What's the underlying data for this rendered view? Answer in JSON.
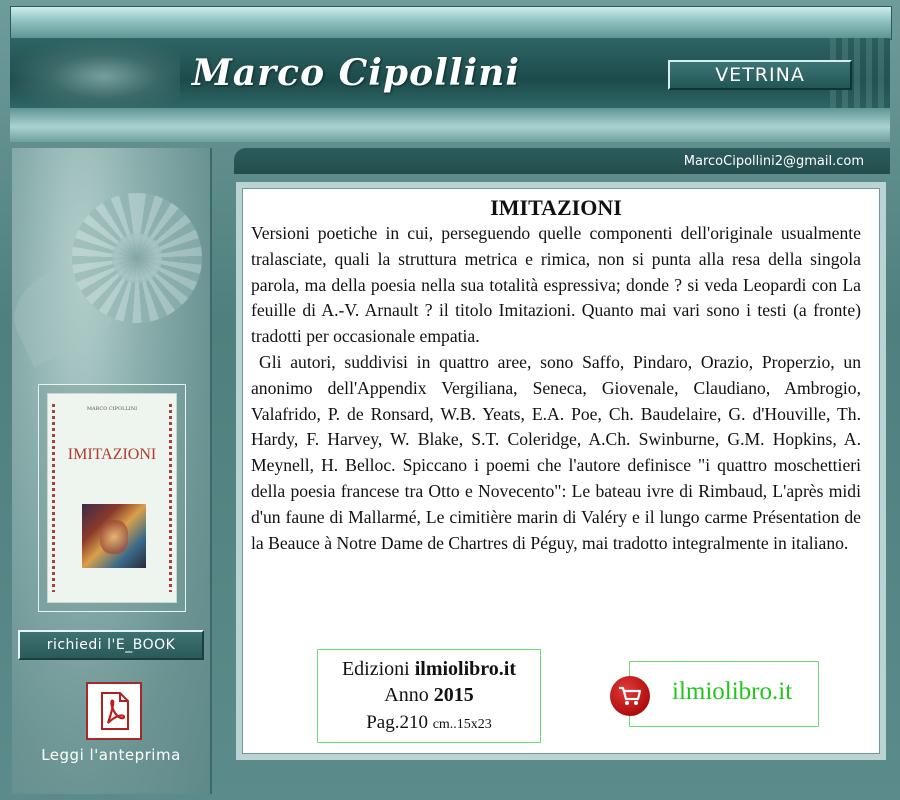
{
  "header": {
    "title": "Marco Cipollini",
    "vetrina_label": "VETRINA"
  },
  "contact": {
    "email": "MarcoCipollini2@gmail.com"
  },
  "sidebar": {
    "book_cover": {
      "author": "MARCO CIPOLLINI",
      "title": "IMITAZIONI"
    },
    "ebook_label": "richiedi l'E_BOOK",
    "preview_label": "Leggi l'anteprima"
  },
  "main": {
    "heading": "IMITAZIONI",
    "paragraphs": [
      "Versioni poetiche in cui, perseguendo quelle componenti dell'originale usualmente tralasciate, quali la struttura metrica e rimica, non si punta alla resa della singola parola, ma della poesia nella sua totalità espressiva; donde ? si veda Leopardi con La feuille di A.-V. Arnault ? il titolo Imitazioni. Quanto mai vari sono i testi (a fronte) tradotti per occasionale empatia.",
      "Gli autori, suddivisi in quattro aree, sono Saffo, Pindaro, Orazio, Properzio, un anonimo dell'Appendix Vergiliana, Seneca, Giovenale, Claudiano, Ambrogio, Valafrido, P. de Ronsard, W.B. Yeats, E.A. Poe, Ch. Baudelaire, G. d'Houville, Th. Hardy, F. Harvey, W. Blake, S.T. Coleridge, A.Ch. Swinburne, G.M. Hopkins, A. Meynell, H. Belloc. Spiccano i poemi che l'autore definisce \"i quattro moschettieri della poesia francese tra Otto e Novecento\": Le bateau ivre di Rimbaud, L'après midi d'un faune di Mallarmé, Le cimitière marin di Valéry e il lungo carme Présentation de la Beauce à Notre Dame de Chartres di Péguy, mai tradotto integralmente in italiano."
    ],
    "publisher": {
      "prefix": "Edizioni",
      "name": "ilmiolibro.it",
      "year_label": "Anno",
      "year": "2015",
      "pages": "Pag.210",
      "size": "cm..15x23"
    },
    "shop_label": "ilmiolibro.it"
  },
  "colors": {
    "accent_green": "#22c51c",
    "cart_red": "#c41414",
    "teal_dark": "#1d4b4b"
  }
}
